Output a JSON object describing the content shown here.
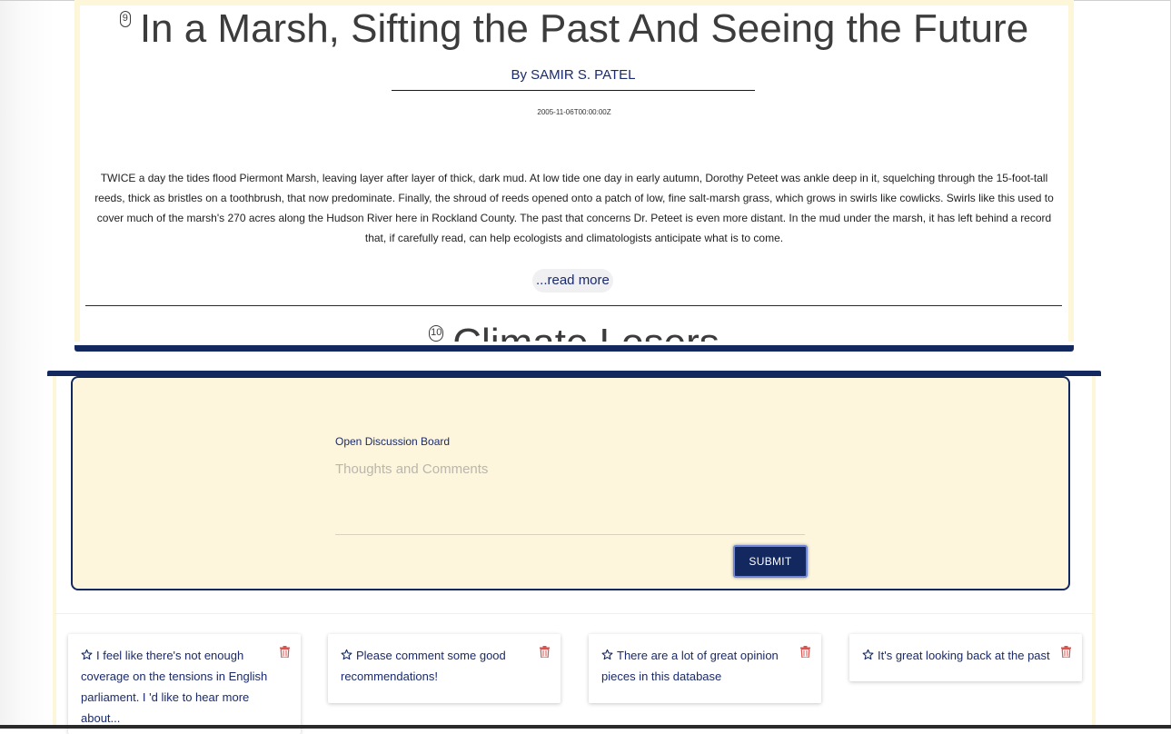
{
  "article": {
    "number": "9",
    "title": "In a Marsh, Sifting the Past And Seeing the Future",
    "byline": "By SAMIR S. PATEL",
    "date": "2005-11-06T00:00:00Z",
    "body": "TWICE a day the tides flood Piermont Marsh, leaving layer after layer of thick, dark mud. At low tide one day in early autumn, Dorothy Peteet was ankle deep in it, squelching through the 15-foot-tall reeds, thick as bristles on a toothbrush, that now predominate. Finally, the shroud of reeds opened onto a patch of low, fine salt-marsh grass, which grows in swirls like cowlicks. Swirls like this used to cover much of the marsh's 270 acres along the Hudson River here in Rockland County. The past that concerns Dr. Peteet is even more distant. In the mud under the marsh, it has left behind a record that, if carefully read, can help ecologists and climatologists anticipate what is to come.",
    "read_more": "...read more"
  },
  "next_article": {
    "number": "10",
    "title": "Climate Losers"
  },
  "discussion": {
    "label": "Open Discussion Board",
    "placeholder": "Thoughts and Comments",
    "submit": "SUBMIT"
  },
  "comments": [
    {
      "text": "I feel like there's not enough coverage on the tensions in English parliament. I 'd like to hear more about..."
    },
    {
      "text": "Please comment some good recommendations!"
    },
    {
      "text": "There are a lot of great opinion pieces in this database"
    },
    {
      "text": "It's great looking back at the past"
    }
  ],
  "colors": {
    "navy": "#13285e",
    "cream": "#fdf6dc",
    "delete_red": "#d9534f"
  },
  "icons": {
    "favorite": "star-outline-icon",
    "delete": "trash-icon"
  }
}
